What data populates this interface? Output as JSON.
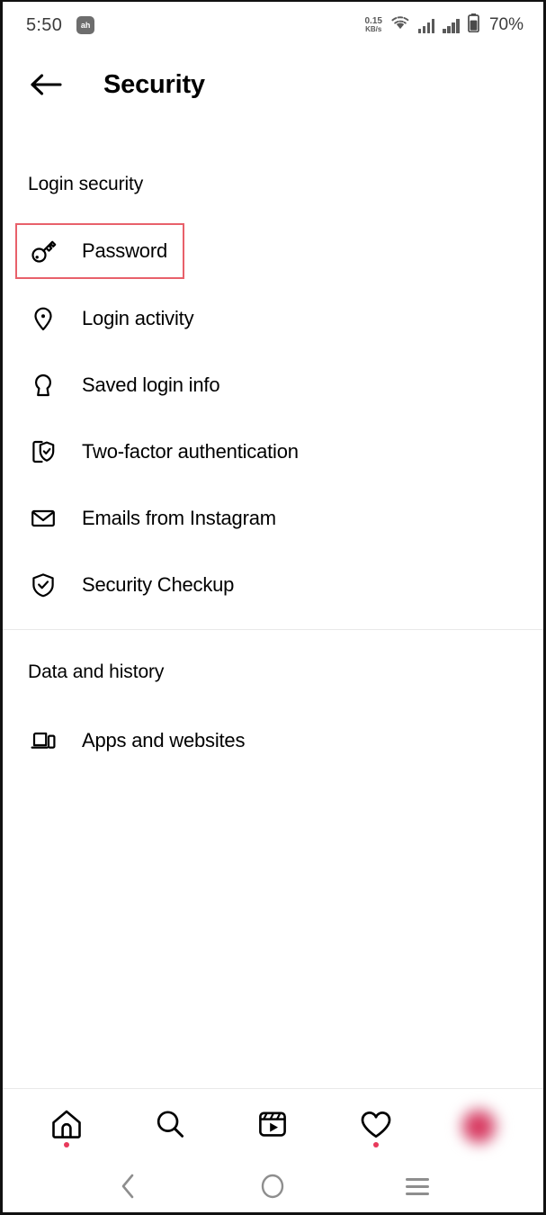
{
  "status_bar": {
    "time": "5:50",
    "app_icon_label": "ah",
    "network_speed_value": "0.15",
    "network_speed_unit": "KB/s",
    "wifi_icon": "wifi-icon",
    "signal_1_icon": "signal-bars-icon",
    "signal_2_icon": "signal-bars-icon",
    "battery_icon": "battery-icon",
    "battery_percent": "70%"
  },
  "header": {
    "back_icon": "back-arrow-icon",
    "title": "Security"
  },
  "sections": [
    {
      "title": "Login security",
      "items": [
        {
          "label": "Password",
          "icon": "key-icon",
          "highlighted": true
        },
        {
          "label": "Login activity",
          "icon": "location-pin-icon",
          "highlighted": false
        },
        {
          "label": "Saved login info",
          "icon": "keyhole-icon",
          "highlighted": false
        },
        {
          "label": "Two-factor authentication",
          "icon": "phone-shield-check-icon",
          "highlighted": false
        },
        {
          "label": "Emails from Instagram",
          "icon": "envelope-icon",
          "highlighted": false
        },
        {
          "label": "Security Checkup",
          "icon": "shield-check-icon",
          "highlighted": false
        }
      ]
    },
    {
      "title": "Data and history",
      "items": [
        {
          "label": "Apps and websites",
          "icon": "laptop-phone-icon",
          "highlighted": false
        }
      ]
    }
  ],
  "bottom_nav": {
    "items": [
      {
        "name": "home",
        "icon": "home-icon",
        "badge_dot": true
      },
      {
        "name": "search",
        "icon": "search-icon",
        "badge_dot": false
      },
      {
        "name": "reels",
        "icon": "reels-icon",
        "badge_dot": false
      },
      {
        "name": "activity",
        "icon": "heart-icon",
        "badge_dot": true
      },
      {
        "name": "profile",
        "icon": "avatar-icon",
        "badge_dot": false
      }
    ]
  },
  "system_nav": {
    "back_icon": "chevron-left-icon",
    "home_icon": "circle-icon",
    "recents_icon": "hamburger-icon"
  },
  "colors": {
    "highlight_border": "#e8606a",
    "badge_dot": "#e8395b",
    "divider": "#e9e9e9",
    "text_primary": "#000000",
    "status_text": "#3c3c3c"
  }
}
